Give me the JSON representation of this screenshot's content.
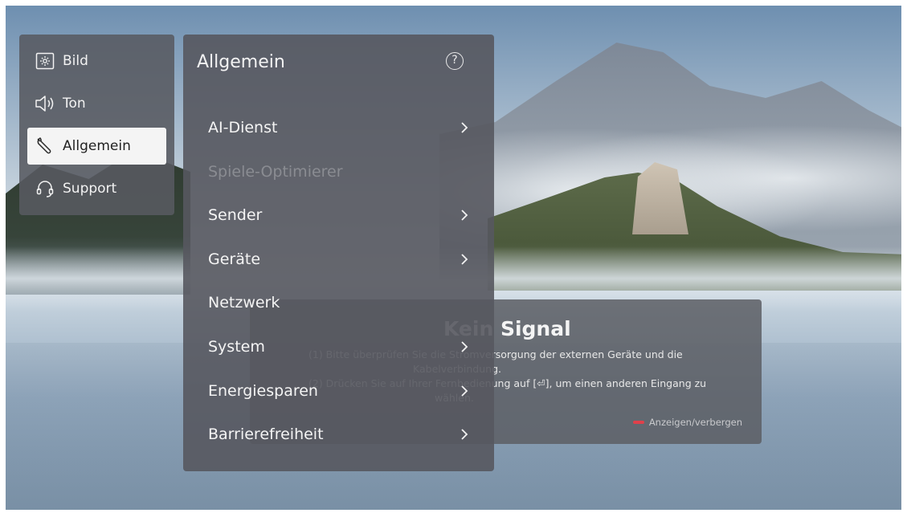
{
  "side_menu": {
    "items": [
      {
        "label": "Bild",
        "icon": "picture-icon",
        "selected": false
      },
      {
        "label": "Ton",
        "icon": "speaker-icon",
        "selected": false
      },
      {
        "label": "Allgemein",
        "icon": "wrench-icon",
        "selected": true
      },
      {
        "label": "Support",
        "icon": "headset-icon",
        "selected": false
      }
    ]
  },
  "panel": {
    "title": "Allgemein",
    "help_icon": "?",
    "items": [
      {
        "label": "AI-Dienst",
        "has_arrow": true,
        "enabled": true
      },
      {
        "label": "Spiele-Optimierer",
        "has_arrow": false,
        "enabled": false
      },
      {
        "label": "Sender",
        "has_arrow": true,
        "enabled": true
      },
      {
        "label": "Geräte",
        "has_arrow": true,
        "enabled": true
      },
      {
        "label": "Netzwerk",
        "has_arrow": false,
        "enabled": true
      },
      {
        "label": "System",
        "has_arrow": true,
        "enabled": true
      },
      {
        "label": "Energiesparen",
        "has_arrow": true,
        "enabled": true
      },
      {
        "label": "Barrierefreiheit",
        "has_arrow": true,
        "enabled": true
      }
    ]
  },
  "no_signal": {
    "title": "Kein Signal",
    "line1": "(1) Bitte überprüfen Sie die Stromversorgung der externen Geräte und die",
    "line2": "Kabelverbindung.",
    "line3": "(2) Drücken Sie auf Ihrer Fernbedienung auf [⏎], um einen anderen Eingang zu",
    "line4": "wählen.",
    "toggle_hint": "Anzeigen/verbergen"
  },
  "colors": {
    "accent_red": "#e0404a",
    "selected_bg": "#f4f4f4",
    "panel_bg": "#56585f"
  }
}
